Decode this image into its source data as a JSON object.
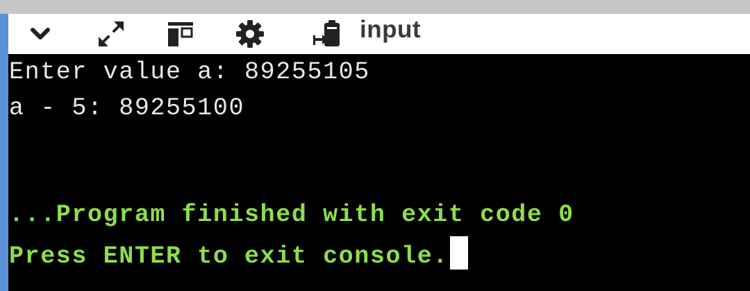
{
  "toolbar": {
    "icons": [
      "chevron-down-icon",
      "expand-arrows-icon",
      "layout-panel-icon",
      "gear-icon",
      "clipboard-input-icon"
    ],
    "input_label": "input"
  },
  "console": {
    "lines": [
      "Enter value a: 89255105",
      "a - 5: 89255100",
      "...Program finished with exit code 0",
      "Press ENTER to exit console."
    ]
  },
  "colors": {
    "toolbar_bg": "#ffffff",
    "console_bg": "#000000",
    "output_text": "#e9e9e9",
    "finish_text": "#8ede49",
    "rail": "#5b8fd6"
  }
}
